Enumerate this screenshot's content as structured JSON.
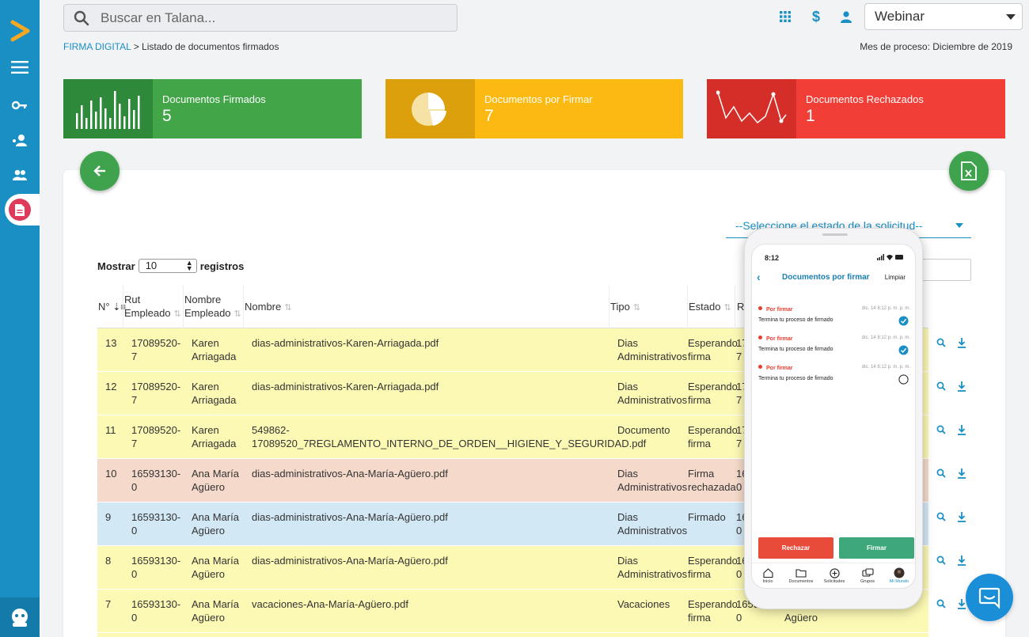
{
  "sidebar": {
    "items": [
      "menu-icon",
      "key-icon",
      "user-settings-icon",
      "users-icon",
      "document-icon"
    ],
    "active": "document-icon"
  },
  "search": {
    "placeholder": "Buscar en Talana..."
  },
  "topbar": {
    "company": "Webinar",
    "icons": [
      "apps-icon",
      "dollar-icon",
      "person-icon"
    ]
  },
  "breadcrumb": {
    "link": "FIRMA DIGITAL",
    "separator": ">",
    "current": "Listado de documentos firmados"
  },
  "process_month": "Mes de proceso: Diciembre de 2019",
  "cards": [
    {
      "label": "Documentos Firmados",
      "value": "5",
      "color": "#42a548",
      "icon": "bar-chart-icon"
    },
    {
      "label": "Documentos por Firmar",
      "value": "7",
      "color": "#fbb911",
      "icon": "pie-chart-icon"
    },
    {
      "label": "Documentos Rechazados",
      "value": "1",
      "color": "#f13e36",
      "icon": "line-chart-icon"
    }
  ],
  "state_select": {
    "value": "--Seleccione el estado de la solicitud--"
  },
  "show_entries": {
    "prefix": "Mostrar",
    "value": "10",
    "suffix": "registros"
  },
  "table": {
    "headers": {
      "n": "N°",
      "rut": [
        "Rut",
        "Empleado"
      ],
      "nombre_empleado": [
        "Nombre",
        "Empleado"
      ],
      "nombre": "Nombre",
      "tipo": "Tipo",
      "estado": "Estado",
      "r": "R"
    },
    "rows": [
      {
        "n": "13",
        "rut": [
          "17089520-",
          "7"
        ],
        "emp": [
          "Karen",
          "Arriagada"
        ],
        "file": [
          "dias-administrativos-Karen-Arriagada.pdf",
          ""
        ],
        "tipo": [
          "Dias",
          "Administrativos"
        ],
        "estado": [
          "Esperando",
          "firma"
        ],
        "extra": [
          "17",
          "7"
        ],
        "color": "yellow"
      },
      {
        "n": "12",
        "rut": [
          "17089520-",
          "7"
        ],
        "emp": [
          "Karen",
          "Arriagada"
        ],
        "file": [
          "dias-administrativos-Karen-Arriagada.pdf",
          ""
        ],
        "tipo": [
          "Dias",
          "Administrativos"
        ],
        "estado": [
          "Esperando",
          "firma"
        ],
        "extra": [
          "17",
          "7"
        ],
        "color": "yellow"
      },
      {
        "n": "11",
        "rut": [
          "17089520-",
          "7"
        ],
        "emp": [
          "Karen",
          "Arriagada"
        ],
        "file": [
          "549862-",
          "17089520_7REGLAMENTO_INTERNO_DE_ORDEN__HIGIENE_Y_SEGURIDAD.pdf"
        ],
        "tipo": [
          "Documento",
          ""
        ],
        "estado": [
          "Esperando",
          "firma"
        ],
        "extra": [
          "17",
          "7"
        ],
        "color": "yellow"
      },
      {
        "n": "10",
        "rut": [
          "16593130-",
          "0"
        ],
        "emp": [
          "Ana María",
          "Agüero"
        ],
        "file": [
          "dias-administrativos-Ana-María-Agüero.pdf",
          ""
        ],
        "tipo": [
          "Dias",
          "Administrativos"
        ],
        "estado": [
          "Firma",
          "rechazada"
        ],
        "extra": [
          "16",
          "0"
        ],
        "color": "red"
      },
      {
        "n": "9",
        "rut": [
          "16593130-",
          "0"
        ],
        "emp": [
          "Ana María",
          "Agüero"
        ],
        "file": [
          "dias-administrativos-Ana-María-Agüero.pdf",
          ""
        ],
        "tipo": [
          "Dias",
          "Administrativos"
        ],
        "estado": [
          "Firmado",
          ""
        ],
        "extra": [
          "16",
          "0"
        ],
        "color": "blue"
      },
      {
        "n": "8",
        "rut": [
          "16593130-",
          "0"
        ],
        "emp": [
          "Ana María",
          "Agüero"
        ],
        "file": [
          "dias-administrativos-Ana-María-Agüero.pdf",
          ""
        ],
        "tipo": [
          "Dias",
          "Administrativos"
        ],
        "estado": [
          "Esperando",
          "firma"
        ],
        "extra": [
          "16",
          "0"
        ],
        "color": "yellow"
      },
      {
        "n": "7",
        "rut": [
          "16593130-",
          "0"
        ],
        "emp": [
          "Ana María",
          "Agüero"
        ],
        "file": [
          "vacaciones-Ana-María-Agüero.pdf",
          ""
        ],
        "tipo": [
          "Vacaciones",
          ""
        ],
        "estado": [
          "Esperando",
          "firma"
        ],
        "extra": [
          "1659",
          "0"
        ],
        "extra2": "Agüero",
        "color": "yellow"
      }
    ]
  },
  "phone": {
    "time": "8:12",
    "title": "Documentos por firmar",
    "clear": "Limpiar",
    "items": [
      {
        "status": "Por firmar",
        "date": "dic. 14 8:12 p. m. p. m.",
        "msg": "Termina tu proceso de firmado",
        "checked": true
      },
      {
        "status": "Por firmar",
        "date": "dic. 14 8:12 p. m. p. m.",
        "msg": "Termina tu proceso de firmado",
        "checked": true
      },
      {
        "status": "Por firmar",
        "date": "dic. 14 8:12 p. m. p. m.",
        "msg": "Termina tu proceso de firmado",
        "checked": false
      }
    ],
    "reject": "Rechazar",
    "sign": "Firmar",
    "tabs": [
      "Inicio",
      "Documentos",
      "Solicitudes",
      "Grupos",
      "Mi Mundo"
    ]
  }
}
